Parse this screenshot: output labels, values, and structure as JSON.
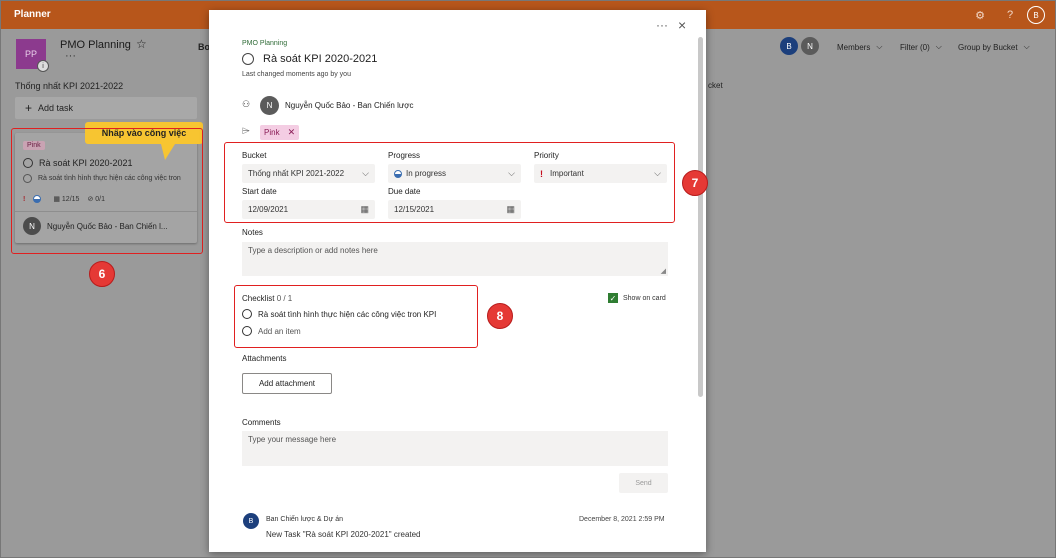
{
  "app": {
    "title": "Planner",
    "user_initial": "B"
  },
  "plan": {
    "logo": "PP",
    "name": "PMO Planning",
    "board_tab": "Bo",
    "info": "i"
  },
  "header_right": {
    "avatars": [
      {
        "initial": "B",
        "color": "#1c3f7c"
      },
      {
        "initial": "N",
        "color": "#5b5b5b"
      }
    ],
    "members": "Members",
    "filter": "Filter (0)",
    "group_by": "Group by Bucket"
  },
  "board": {
    "bucket_title": "Thống nhất KPI 2021-2022",
    "bucket_title_2": "cket",
    "add_task": "Add task",
    "task_card": {
      "label": "Pink",
      "title": "Rà soát KPI 2020-2021",
      "checklist_item": "Rà soát tình hình thực hiện các công việc tron",
      "due": "12/15",
      "checklist_count": "0/1",
      "assignee_initial": "N",
      "assignee": "Nguyễn Quốc Bảo - Ban Chiến l..."
    },
    "callout": "Nhấp vào công việc"
  },
  "badges": {
    "six": "6",
    "seven": "7",
    "eight": "8"
  },
  "task": {
    "plan_name": "PMO Planning",
    "title": "Rà soát KPI 2020-2021",
    "last_changed": "Last changed moments ago by you",
    "assignee_initial": "N",
    "assignee": "Nguyễn Quốc Bảo - Ban Chiến lược",
    "label": "Pink",
    "fields": {
      "bucket_label": "Bucket",
      "bucket_value": "Thống nhất KPI 2021-2022",
      "progress_label": "Progress",
      "progress_value": "In progress",
      "priority_label": "Priority",
      "priority_value": "Important",
      "start_label": "Start date",
      "start_value": "12/09/2021",
      "due_label": "Due date",
      "due_value": "12/15/2021"
    },
    "notes_label": "Notes",
    "notes_placeholder": "Type a description or add notes here",
    "checklist": {
      "label": "Checklist",
      "count": "0 / 1",
      "show_on_card": "Show on card",
      "items": [
        "Rà soát tình hình thực hiện các công việc tron KPI"
      ],
      "add_item": "Add an item"
    },
    "attachments_label": "Attachments",
    "add_attachment": "Add attachment",
    "comments_label": "Comments",
    "comment_placeholder": "Type your message here",
    "send": "Send",
    "activity": {
      "user_initial": "B",
      "user": "Ban Chiến lược & Dự án",
      "date": "December 8, 2021 2:59 PM",
      "text": "New Task \"Rà soát KPI 2020-2021\" created"
    }
  },
  "colors": {
    "topbar": "#b7561b",
    "accent_green": "#2f6b37",
    "highlight_red": "#e02020",
    "callout_yellow": "#f7c531"
  },
  "icons": [
    "settings-gear-icon",
    "help-icon",
    "star-icon",
    "plus-icon",
    "more-dots-icon",
    "close-icon",
    "person-icon",
    "tag-icon",
    "chevron-down-icon",
    "calendar-icon",
    "progress-half-icon",
    "important-exclamation-icon"
  ]
}
